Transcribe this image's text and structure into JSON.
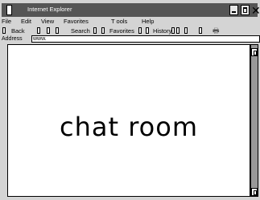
{
  "window": {
    "title": "Internet Explorer"
  },
  "menu": [
    {
      "label": "File"
    },
    {
      "label": "Edit"
    },
    {
      "label": "View"
    },
    {
      "label": "Favorites"
    },
    {
      "label": "T ools"
    },
    {
      "label": "Help"
    }
  ],
  "toolbar": {
    "back_label": "Back",
    "search_label": "Search",
    "favorites_label": "Favorites",
    "history_label": "History"
  },
  "address": {
    "label": "Address",
    "value": "www."
  },
  "content": {
    "text": "chat room"
  }
}
